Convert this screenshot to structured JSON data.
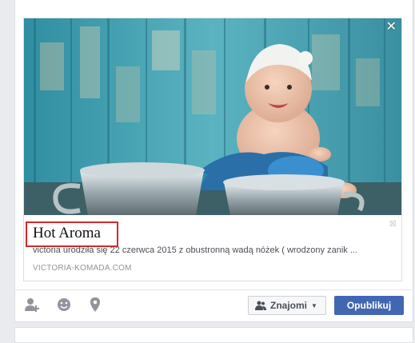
{
  "preview": {
    "title": "Hot Aroma",
    "description": "victoria urodziła się 22 czerwca 2015 z obustronną wadą nóżek ( wrodzony zanik ...",
    "domain": "VICTORIA-KOMADA.COM",
    "close_glyph": "✕",
    "remove_glyph": "⊠"
  },
  "actions": {
    "icons": [
      "tag-friends-icon",
      "feeling-icon",
      "location-icon"
    ],
    "audience_label": "Znajomi",
    "publish_label": "Opublikuj"
  },
  "colors": {
    "accent": "#4267b2",
    "highlight_box": "#d32a2a"
  }
}
